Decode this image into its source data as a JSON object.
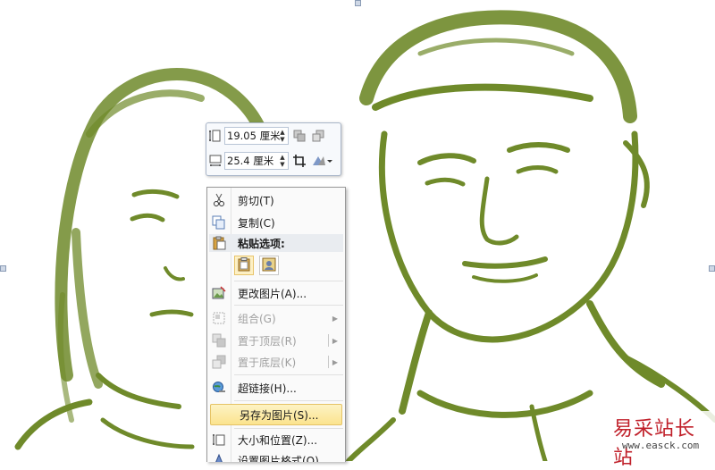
{
  "colors": {
    "photo_ink": "#6f8a2a",
    "highlight": "#fbe38e",
    "watermark_red": "#c0202a"
  },
  "minibar": {
    "height_value": "19.05 厘米",
    "width_value": "25.4 厘米"
  },
  "menu": {
    "cut": "剪切(T)",
    "copy": "复制(C)",
    "paste_options": "粘贴选项:",
    "change_picture": "更改图片(A)...",
    "group": "组合(G)",
    "bring_to_front": "置于顶层(R)",
    "send_to_back": "置于底层(K)",
    "hyperlink": "超链接(H)...",
    "save_as_picture": "另存为图片(S)...",
    "size_position": "大小和位置(Z)...",
    "format_picture": "设置图片格式(O)..."
  },
  "watermark": {
    "title": "易采站长站",
    "url": "www.easck.com"
  }
}
